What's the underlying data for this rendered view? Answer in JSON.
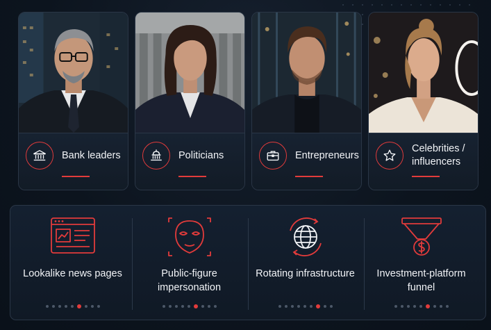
{
  "colors": {
    "accent": "#e23b3b",
    "background": "#0c141e",
    "card_border": "#2a3646"
  },
  "personas": [
    {
      "label": "Bank leaders",
      "icon": "bank-icon"
    },
    {
      "label": "Politicians",
      "icon": "capitol-icon"
    },
    {
      "label": "Entrepreneurs",
      "icon": "briefcase-icon"
    },
    {
      "label": "Celebrities / influencers",
      "icon": "star-icon"
    }
  ],
  "tactics": [
    {
      "label": "Lookalike news pages",
      "icon": "news-page-icon",
      "dots": 9,
      "active_dot": 5
    },
    {
      "label": "Public-figure impersonation",
      "icon": "mask-icon",
      "dots": 9,
      "active_dot": 5
    },
    {
      "label": "Rotating infrastructure",
      "icon": "rotating-globe-icon",
      "dots": 9,
      "active_dot": 6
    },
    {
      "label": "Investment-platform funnel",
      "icon": "money-funnel-icon",
      "dots": 9,
      "active_dot": 5
    }
  ]
}
